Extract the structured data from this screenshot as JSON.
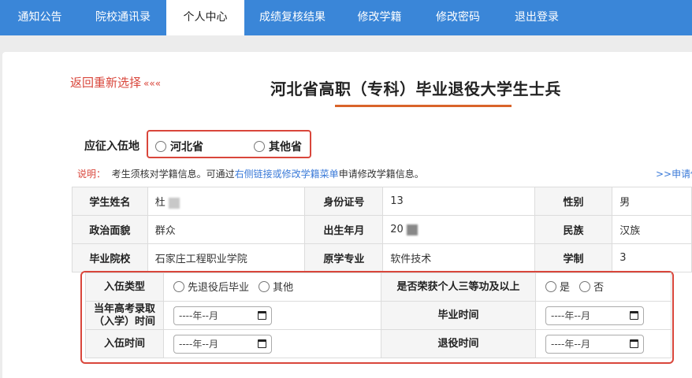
{
  "nav": {
    "items": [
      {
        "label": "通知公告",
        "active": false
      },
      {
        "label": "院校通讯录",
        "active": false
      },
      {
        "label": "个人中心",
        "active": true
      },
      {
        "label": "成绩复核结果",
        "active": false
      },
      {
        "label": "修改学籍",
        "active": false
      },
      {
        "label": "修改密码",
        "active": false
      },
      {
        "label": "退出登录",
        "active": false
      }
    ]
  },
  "header": {
    "back_link": "返回重新选择",
    "back_arrows": "«««",
    "title": "河北省高职（专科）毕业退役大学生士兵"
  },
  "enlist_place": {
    "label": "应征入伍地",
    "options": [
      "河北省",
      "其他省"
    ]
  },
  "note": {
    "label": "说明：",
    "text_before": "考生须核对学籍信息。可通过",
    "link_text": "右侧链接或修改学籍菜单",
    "text_after": "申请修改学籍信息。",
    "side_link": ">>申请修"
  },
  "student_info": {
    "rows": [
      [
        {
          "label": "学生姓名",
          "value": "杜"
        },
        {
          "label": "身份证号",
          "value": "13"
        },
        {
          "label": "性别",
          "value": "男"
        }
      ],
      [
        {
          "label": "政治面貌",
          "value": "群众"
        },
        {
          "label": "出生年月",
          "value": "20"
        },
        {
          "label": "民族",
          "value": "汉族"
        }
      ],
      [
        {
          "label": "毕业院校",
          "value": "石家庄工程职业学院"
        },
        {
          "label": "原学专业",
          "value": "软件技术"
        },
        {
          "label": "学制",
          "value": "3"
        }
      ]
    ]
  },
  "service": {
    "enlist_type_label": "入伍类型",
    "enlist_type_options": [
      "先退役后毕业",
      "其他"
    ],
    "honor_label": "是否荣获个人三等功及以上",
    "honor_options": [
      "是",
      "否"
    ],
    "admission_label_line1": "当年高考录取",
    "admission_label_line2": "（入学）时间",
    "graduation_label": "毕业时间",
    "enlist_time_label": "入伍时间",
    "retire_label": "退役时间",
    "date_placeholder": "----年--月"
  }
}
